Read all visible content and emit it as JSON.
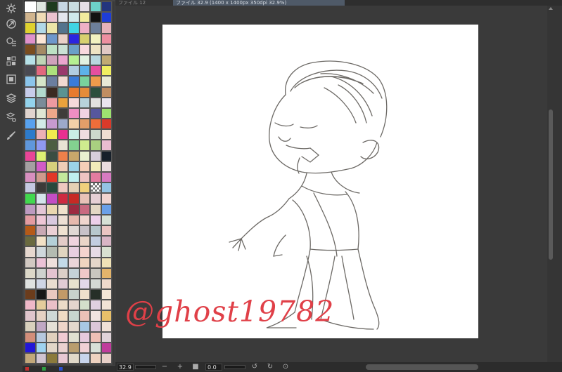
{
  "document_tabs": [
    {
      "label": "ファイル 12",
      "active": false
    },
    {
      "label": "ファイル 32.9 (1400 x 1400px 350dpi 32.9%)",
      "active": true
    }
  ],
  "tools": [
    {
      "name": "gear-icon"
    },
    {
      "name": "navigator-icon"
    },
    {
      "name": "sub-view-icon"
    },
    {
      "name": "color-set-icon"
    },
    {
      "name": "layer-property-icon"
    },
    {
      "name": "layers-icon"
    },
    {
      "name": "layer-search-icon"
    },
    {
      "name": "brush-icon"
    }
  ],
  "palette": {
    "colors": [
      "#ffffff",
      "#dfe6e0",
      "#1e3b1e",
      "#c7d7e4",
      "#c9dde1",
      "#e6dfe7",
      "#6dd2c9",
      "#23357e",
      "#d1b58e",
      "#f0dcb5",
      "#ebc3cf",
      "#e4e6ee",
      "#cfe9ec",
      "#f2ec9e",
      "#121212",
      "#1e3dd8",
      "#dfd12f",
      "#b1d8e8",
      "#ece5a8",
      "#54738d",
      "#3fd4e5",
      "#edb0c6",
      "#6d7f9a",
      "#e6b2b9",
      "#df91cb",
      "#fde6d6",
      "#6e97cb",
      "#ead0c8",
      "#2a24e0",
      "#d8d06f",
      "#f2f1c0",
      "#ed8fa0",
      "#7a4d1f",
      "#a48a65",
      "#bde1c4",
      "#cbe1d5",
      "#6aa0c7",
      "#f9d9de",
      "#efe3c3",
      "#e1c8c4",
      "#b6e1e7",
      "#bfd6b6",
      "#cfa3bb",
      "#eba6cf",
      "#b6ef92",
      "#e3f2e1",
      "#b8d7de",
      "#c1aa73",
      "#4a4a52",
      "#e2687e",
      "#ade07c",
      "#99396c",
      "#b2cde0",
      "#5db2e9",
      "#e64fa0",
      "#f0ed61",
      "#8bc5eb",
      "#d5e6c9",
      "#6b7e9f",
      "#f1d9d1",
      "#3a7bd8",
      "#79d39d",
      "#ef9b4c",
      "#e8e8d5",
      "#c7ccea",
      "#b2d9cd",
      "#3b2a22",
      "#5a9392",
      "#e77a2e",
      "#e48c3a",
      "#2d4f3d",
      "#c08d62",
      "#93d3ec",
      "#7b8c99",
      "#ed9aa0",
      "#eba23c",
      "#f6d9da",
      "#b7d2dc",
      "#e2e1e0",
      "#eae5ef",
      "#e0d4ce",
      "#dfe6d3",
      "#eda78a",
      "#3f3c3a",
      "#ee8ec2",
      "#f0d3e4",
      "#57579e",
      "#9de270",
      "#58a2ef",
      "#d2ebe7",
      "#c79ad0",
      "#9da9cb",
      "#f2d0a8",
      "#e39e69",
      "#ee6d3a",
      "#da3a2a",
      "#2d7bcb",
      "#ecb1b5",
      "#f0ea4f",
      "#ea2f90",
      "#c9efe6",
      "#f0dce0",
      "#cdd8cc",
      "#f0ded2",
      "#5f97dc",
      "#8f9af1",
      "#4c5e41",
      "#e8e3d4",
      "#83d290",
      "#cfec8e",
      "#a9d080",
      "#eabcd0",
      "#e94597",
      "#dcf173",
      "#3a4d42",
      "#ef804a",
      "#c8a76b",
      "#e8f1d0",
      "#d7cdda",
      "#17202a",
      "#a4a0a1",
      "#d25cc7",
      "#d7d07c",
      "#f0cdb6",
      "#9bd3e8",
      "#f5cfb8",
      "#f2ebba",
      "#eadcde",
      "#d78fbf",
      "#cf9a8d",
      "#e13728",
      "#c4e89c",
      "#bfeff0",
      "#eec4c2",
      "#e27ca0",
      "#d77bc2",
      "#c4c9e1",
      "#3c3a38",
      "#27483c",
      "#eec8c0",
      "#e4d0b4",
      "#f0d07c",
      "#transparent",
      "#94c4e4",
      "#41d84e",
      "#d4e4ea",
      "#c34ec4",
      "#ce2a40",
      "#c72a24",
      "#e8c2b8",
      "#e6cfd5",
      "#f0d4d0",
      "#bd9ac0",
      "#e4c6d6",
      "#e9d7b0",
      "#f0e2cc",
      "#9c2a40",
      "#c96a80",
      "#e3d7c4",
      "#6aa0e8",
      "#e39ba1",
      "#eec6d6",
      "#d9c9df",
      "#eee0d4",
      "#e6b9ad",
      "#f0d6ce",
      "#edd0ea",
      "#d6e0d5",
      "#b55a18",
      "#c9a9b4",
      "#ebd0d5",
      "#f0e2d1",
      "#e0d8d4",
      "#c8c2c8",
      "#b7c7cd",
      "#eac5c2",
      "#6a6a3f",
      "#f2e1c6",
      "#b5d0d8",
      "#e4ccc8",
      "#f0d4df",
      "#ead5c8",
      "#c2cde0",
      "#d8b5c5",
      "#e6d8cf",
      "#cfd8dc",
      "#b4bbb1",
      "#e1d5c0",
      "#e8cfe0",
      "#f4d4cf",
      "#e6dbe6",
      "#d8e1d1",
      "#d2c9c2",
      "#ebc2d6",
      "#efe0dc",
      "#c3dae8",
      "#ead5d9",
      "#f0d5c0",
      "#e4d6ca",
      "#efe2b7",
      "#dcd8c8",
      "#ced2ce",
      "#e4c4d0",
      "#dcd0c8",
      "#c5d2d8",
      "#efc8c9",
      "#c9c6c0",
      "#e3b46b",
      "#dfe2e0",
      "#cfd6e5",
      "#eaded0",
      "#e1ccd4",
      "#e8e2cd",
      "#e3d8ea",
      "#d5d8d5",
      "#efd9cb",
      "#6b3c1c",
      "#181818",
      "#e8c8c0",
      "#c29a68",
      "#c8d2cc",
      "#eedfcc",
      "#262f28",
      "#f4e6d7",
      "#efb8c8",
      "#e4cc9c",
      "#eac0c8",
      "#ecdcc8",
      "#e4d4cd",
      "#d3dfcb",
      "#dfd0e0",
      "#f1e3d5",
      "#e0c5cc",
      "#e6d2c3",
      "#cfd9d6",
      "#f0dcc4",
      "#c7d6cf",
      "#ecc1b8",
      "#f2e4e0",
      "#e8c06a",
      "#d8d0bd",
      "#c0a8c4",
      "#e4e0d6",
      "#efd6c9",
      "#e4d8cc",
      "#a8c8e4",
      "#dcc6d8",
      "#f0e0d6",
      "#d28e7a",
      "#b6c8de",
      "#e0d0bd",
      "#f0cbd2",
      "#e0e0d0",
      "#e6cadd",
      "#efc0b6",
      "#e0d2d8",
      "#2216d8",
      "#9fd3f0",
      "#e2d6c8",
      "#ead1cf",
      "#b99e6e",
      "#f0d0d5",
      "#d8e0d8",
      "#c03c9c",
      "#c2a87a",
      "#d0c4d0",
      "#8b7a3c",
      "#e8c8d4",
      "#e0d8c8",
      "#c8d4ec",
      "#eed2c0",
      "#e8d0c8"
    ],
    "selected_index": 0
  },
  "watermark": {
    "text": "@ghost19782"
  },
  "statusbar": {
    "zoom": "32.9",
    "angle": "0.0",
    "minus_label": "−",
    "plus_label": "+"
  },
  "colors": {
    "accent_watermark": "#e04048",
    "active_tab": "#4f5a68",
    "workspace": "#3a3a3a"
  }
}
